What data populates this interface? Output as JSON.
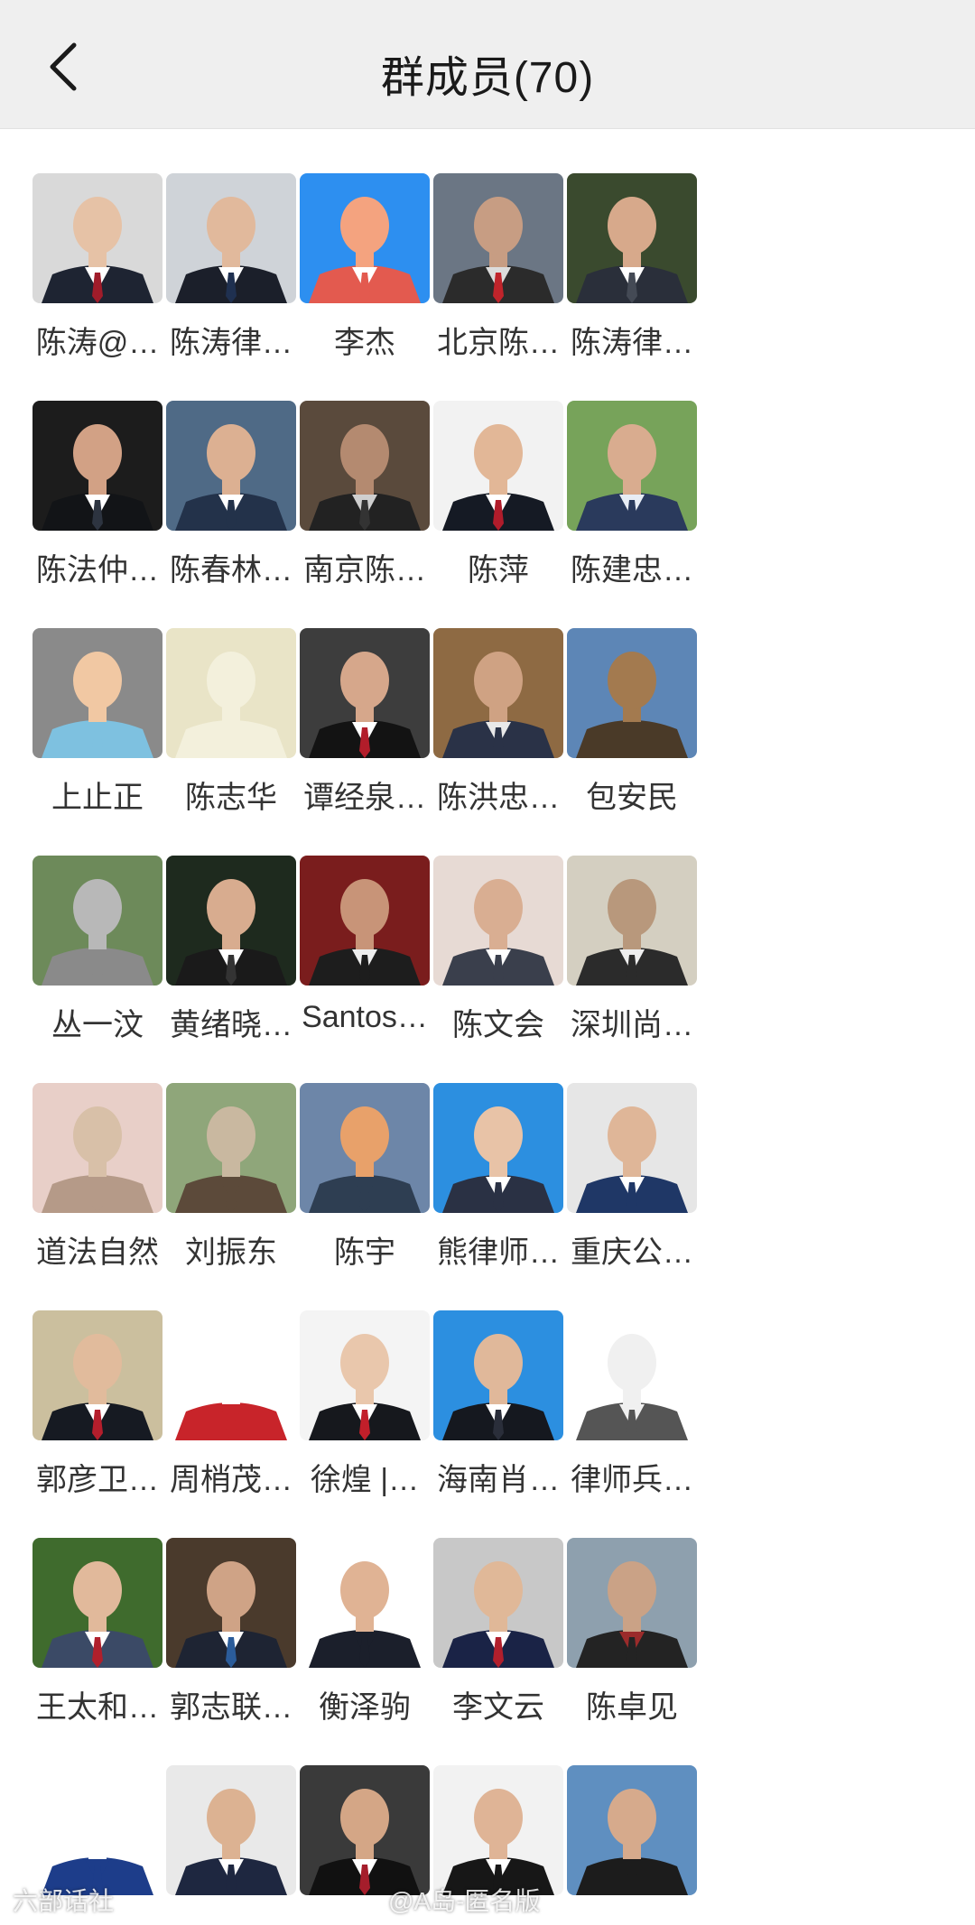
{
  "header": {
    "title": "群成员(70)"
  },
  "members": [
    {
      "name": "陈涛@…",
      "bg": "#d9d9d9",
      "skin": "#e6c2a6",
      "suit": "#1e2432",
      "shirt": "#ffffff",
      "tie": "#a01c2a"
    },
    {
      "name": "陈涛律…",
      "bg": "#cfd3d8",
      "skin": "#e1b99c",
      "suit": "#1b1f2a",
      "shirt": "#ffffff",
      "tie": "#1f3050"
    },
    {
      "name": "李杰",
      "bg": "#2d8ff0",
      "skin": "#f4a37f",
      "suit": "#e35a4f",
      "shirt": "#ffffff",
      "tie": "#e35a4f"
    },
    {
      "name": "北京陈…",
      "bg": "#6b7684",
      "skin": "#c79d83",
      "suit": "#2b2b2b",
      "shirt": "#dcdcdc",
      "tie": "#c0242b"
    },
    {
      "name": "陈涛律…",
      "bg": "#3a4a2e",
      "skin": "#d7a98b",
      "suit": "#2a2f3a",
      "shirt": "#ffffff",
      "tie": "#444a55"
    },
    {
      "name": "陈法仲…",
      "bg": "#1c1c1c",
      "skin": "#d2a185",
      "suit": "#121417",
      "shirt": "#ffffff",
      "tie": "#2d3440"
    },
    {
      "name": "陈春林…",
      "bg": "#4f6a86",
      "skin": "#dcb092",
      "suit": "#23324a",
      "shirt": "#ffffff",
      "tie": "#23324a"
    },
    {
      "name": "南京陈…",
      "bg": "#5a4a3c",
      "skin": "#b48a70",
      "suit": "#222222",
      "shirt": "#cfcfcf",
      "tie": "#333333"
    },
    {
      "name": "陈萍",
      "bg": "#f2f2f2",
      "skin": "#e2b797",
      "suit": "#151a24",
      "shirt": "#ffffff",
      "tie": "#b01c2b"
    },
    {
      "name": "陈建忠…",
      "bg": "#77a35a",
      "skin": "#d9ac8f",
      "suit": "#2a3a5c",
      "shirt": "#e8edf5",
      "tie": "#2a3a5c"
    },
    {
      "name": "上止正",
      "bg": "#8a8a8a",
      "skin": "#f1c8a3",
      "suit": "#7ec1e0",
      "shirt": "#7ec1e0",
      "tie": "#7ec1e0"
    },
    {
      "name": "陈志华",
      "bg": "#e9e4c7",
      "skin": "#f3f0dc",
      "suit": "#f3f0dc",
      "shirt": "#f3f0dc",
      "tie": "#f3f0dc"
    },
    {
      "name": "谭经泉…",
      "bg": "#3d3d3d",
      "skin": "#d6a78b",
      "suit": "#131313",
      "shirt": "#ffffff",
      "tie": "#b21d2a"
    },
    {
      "name": "陈洪忠…",
      "bg": "#8e6a43",
      "skin": "#cfa283",
      "suit": "#2a3247",
      "shirt": "#e9e9e9",
      "tie": "#2a3247"
    },
    {
      "name": "包安民",
      "bg": "#5d86b6",
      "skin": "#a37a4f",
      "suit": "#4a3a28",
      "shirt": "#4a3a28",
      "tie": "#4a3a28"
    },
    {
      "name": "丛一汶",
      "bg": "#6d8a5a",
      "skin": "#b8b8b8",
      "suit": "#8a8a8a",
      "shirt": "#8a8a8a",
      "tie": "#8a8a8a"
    },
    {
      "name": "黄绪晓…",
      "bg": "#1e2a1e",
      "skin": "#d8ac8f",
      "suit": "#1a1a1a",
      "shirt": "#ffffff",
      "tie": "#333333"
    },
    {
      "name": "Santos…",
      "bg": "#7a1d1d",
      "skin": "#c89478",
      "suit": "#1d1d1d",
      "shirt": "#eeeeee",
      "tie": "#1d1d1d"
    },
    {
      "name": "陈文会",
      "bg": "#e7dad4",
      "skin": "#d9ae92",
      "suit": "#3a3f4c",
      "shirt": "#ffffff",
      "tie": "#3a3f4c"
    },
    {
      "name": "深圳尚…",
      "bg": "#d4cfc1",
      "skin": "#b8987c",
      "suit": "#2b2b2b",
      "shirt": "#eeeeee",
      "tie": "#2b2b2b"
    },
    {
      "name": "道法自然",
      "bg": "#e8cfc8",
      "skin": "#d8c0a8",
      "suit": "#b59a88",
      "shirt": "#b59a88",
      "tie": "#b59a88"
    },
    {
      "name": "刘振东",
      "bg": "#8fa67a",
      "skin": "#c9b8a0",
      "suit": "#5c4a3a",
      "shirt": "#5c4a3a",
      "tie": "#5c4a3a"
    },
    {
      "name": "陈宇",
      "bg": "#6d86a8",
      "skin": "#e8a16a",
      "suit": "#2e3e52",
      "shirt": "#2e3e52",
      "tie": "#2e3e52"
    },
    {
      "name": "熊律师…",
      "bg": "#2c8fe0",
      "skin": "#e8c3a7",
      "suit": "#2a3144",
      "shirt": "#ffffff",
      "tie": "#2a3144"
    },
    {
      "name": "重庆公…",
      "bg": "#e6e6e6",
      "skin": "#dfb698",
      "suit": "#1f3766",
      "shirt": "#ffffff",
      "tie": "#1f3766"
    },
    {
      "name": "郭彦卫…",
      "bg": "#cbbf9e",
      "skin": "#e1bb9c",
      "suit": "#161a22",
      "shirt": "#ffffff",
      "tie": "#b41e2c"
    },
    {
      "name": "周梢茂…",
      "bg": "#ffffff",
      "skin": "#ffffff",
      "suit": "#c8242a",
      "shirt": "#c8242a",
      "tie": "#c8242a"
    },
    {
      "name": "徐煌 |…",
      "bg": "#f4f4f4",
      "skin": "#e9c7ac",
      "suit": "#16181d",
      "shirt": "#ffffff",
      "tie": "#c21f2a"
    },
    {
      "name": "海南肖…",
      "bg": "#2c8fe0",
      "skin": "#e0b89a",
      "suit": "#15181f",
      "shirt": "#ffffff",
      "tie": "#2a2e3a"
    },
    {
      "name": "律师兵…",
      "bg": "#ffffff",
      "skin": "#f0f0f0",
      "suit": "#555555",
      "shirt": "#f0f0f0",
      "tie": "#555555"
    },
    {
      "name": "王太和…",
      "bg": "#3f6b2d",
      "skin": "#e1b99b",
      "suit": "#3b4a66",
      "shirt": "#ffffff",
      "tie": "#b0202c"
    },
    {
      "name": "郭志联…",
      "bg": "#4a3a2c",
      "skin": "#cfa386",
      "suit": "#1e2433",
      "shirt": "#ffffff",
      "tie": "#2b5c9a"
    },
    {
      "name": "衡泽驹",
      "bg": "#ffffff",
      "skin": "#e0b394",
      "suit": "#1b1f2b",
      "shirt": "#1b1f2b",
      "tie": "#1b1f2b"
    },
    {
      "name": "李文云",
      "bg": "#c8c8c8",
      "skin": "#e0b898",
      "suit": "#1a2346",
      "shirt": "#ffffff",
      "tie": "#b11f2c"
    },
    {
      "name": "陈卓见",
      "bg": "#8ea0ae",
      "skin": "#caa286",
      "suit": "#232323",
      "shirt": "#9b2b2b",
      "tie": "#232323"
    },
    {
      "name": "",
      "bg": "#ffffff",
      "skin": "#ffffff",
      "suit": "#1d3d8a",
      "shirt": "#1d3d8a",
      "tie": "#1d3d8a"
    },
    {
      "name": "",
      "bg": "#e9e9e9",
      "skin": "#dcb292",
      "suit": "#1e2740",
      "shirt": "#ffffff",
      "tie": "#1e2740"
    },
    {
      "name": "",
      "bg": "#3a3a3a",
      "skin": "#d4a686",
      "suit": "#111111",
      "shirt": "#ffffff",
      "tie": "#a51d2b"
    },
    {
      "name": "",
      "bg": "#f2f2f2",
      "skin": "#dfb496",
      "suit": "#171717",
      "shirt": "#ffffff",
      "tie": "#171717"
    },
    {
      "name": "",
      "bg": "#5f8fc0",
      "skin": "#d6aa8c",
      "suit": "#1c1c1c",
      "shirt": "#1c1c1c",
      "tie": "#1c1c1c"
    }
  ],
  "watermark": {
    "left": "六部话社",
    "center": "@A岛-匿名版"
  }
}
